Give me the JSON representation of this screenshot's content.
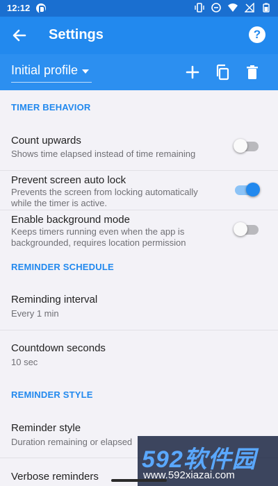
{
  "status_bar": {
    "time": "12:12"
  },
  "app_bar": {
    "title": "Settings"
  },
  "profile_bar": {
    "profile": "Initial profile"
  },
  "sections": {
    "timer_behavior": {
      "header": "TIMER BEHAVIOR",
      "count_upwards": {
        "label": "Count upwards",
        "description": "Shows time elapsed instead of time remaining",
        "enabled": false
      },
      "prevent_lock": {
        "label": "Prevent screen auto lock",
        "description": "Prevents the screen from locking automatically while the timer is active.",
        "enabled": true
      },
      "background_mode": {
        "label": "Enable background mode",
        "description": "Keeps timers running even when the app is backgrounded, requires location permission",
        "enabled": false
      }
    },
    "reminder_schedule": {
      "header": "REMINDER SCHEDULE",
      "interval": {
        "label": "Reminding interval",
        "value": "Every 1 min"
      },
      "countdown": {
        "label": "Countdown seconds",
        "value": "10 sec"
      }
    },
    "reminder_style": {
      "header": "REMINDER STYLE",
      "style": {
        "label": "Reminder style",
        "value": "Duration remaining or elapsed"
      },
      "verbose": {
        "label": "Verbose reminders"
      }
    }
  },
  "watermark": {
    "brand": "592软件园",
    "url": "www.592xiazai.com"
  },
  "colors": {
    "primary": "#2289ee",
    "status_bar": "#1a6fd0",
    "background": "#f3f2f7"
  }
}
